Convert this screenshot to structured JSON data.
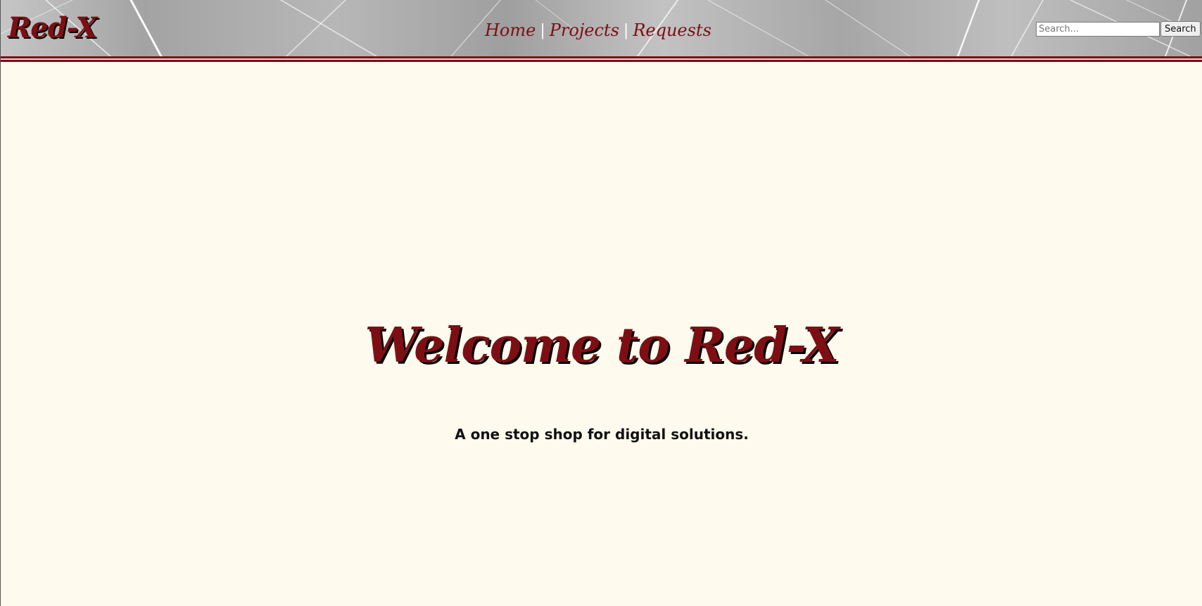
{
  "header": {
    "logo": "Red-X",
    "nav": {
      "items": [
        "Home",
        "Projects",
        "Requests"
      ],
      "separator": "|"
    },
    "search": {
      "placeholder": "Search...",
      "button_label": "Search"
    }
  },
  "main": {
    "title": "Welcome to Red-X",
    "subtitle": "A one stop shop for digital solutions."
  },
  "colors": {
    "brand_red": "#7d0f14",
    "page_background": "#fefaee",
    "header_gray": "#b0b0b0"
  }
}
